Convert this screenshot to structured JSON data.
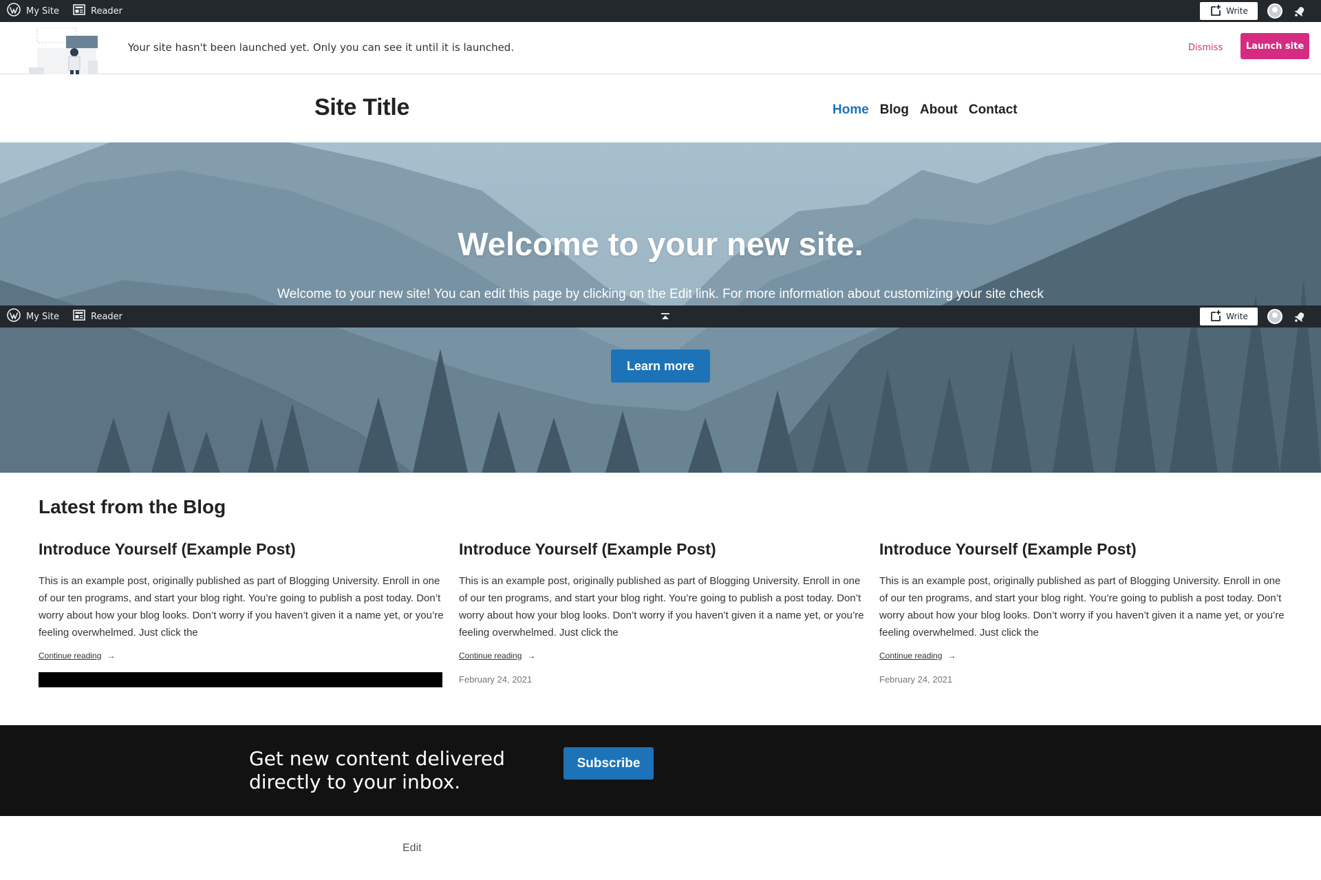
{
  "admin_bar": {
    "my_site_label": "My Site",
    "reader_label": "Reader",
    "write_label": "Write"
  },
  "banner": {
    "message": "Your site hasn't been launched yet. Only you can see it until it is launched.",
    "dismiss_label": "Dismiss",
    "launch_label": "Launch site"
  },
  "header": {
    "site_title": "Site Title",
    "nav": [
      {
        "label": "Home",
        "active": true
      },
      {
        "label": "Blog",
        "active": false
      },
      {
        "label": "About",
        "active": false
      },
      {
        "label": "Contact",
        "active": false
      }
    ]
  },
  "hero": {
    "title": "Welcome to your new site.",
    "text": "Welcome to your new site! You can edit this page by clicking on the Edit link. For more information about customizing your site check",
    "button_label": "Learn more"
  },
  "blog": {
    "heading": "Latest from the Blog",
    "posts": [
      {
        "title": "Introduce Yourself (Example Post)",
        "excerpt": "This is an example post, originally published as part of Blogging University. Enroll in one of our ten programs, and start your blog right. You’re going to publish a post today. Don’t worry about how your blog looks. Don’t worry if you haven’t given it a name yet, or you’re feeling overwhelmed. Just click the",
        "more_label": "Continue reading",
        "arrow": "→",
        "date": ""
      },
      {
        "title": "Introduce Yourself (Example Post)",
        "excerpt": "This is an example post, originally published as part of Blogging University. Enroll in one of our ten programs, and start your blog right. You’re going to publish a post today. Don’t worry about how your blog looks. Don’t worry if you haven’t given it a name yet, or you’re feeling overwhelmed. Just click the",
        "more_label": "Continue reading",
        "arrow": "→",
        "date": "February 24, 2021"
      },
      {
        "title": "Introduce Yourself (Example Post)",
        "excerpt": "This is an example post, originally published as part of Blogging University. Enroll in one of our ten programs, and start your blog right. You’re going to publish a post today. Don’t worry about how your blog looks. Don’t worry if you haven’t given it a name yet, or you’re feeling overwhelmed. Just click the",
        "more_label": "Continue reading",
        "arrow": "→",
        "date": "February 24, 2021"
      }
    ]
  },
  "subscribe": {
    "text_line1": "Get new content delivered",
    "text_line2": "directly to your inbox.",
    "button_label": "Subscribe"
  },
  "footer": {
    "edit_label": "Edit"
  },
  "colors": {
    "admin_bar_bg": "#23282d",
    "launch_button": "#d52c82",
    "dismiss_link": "#c9356e",
    "accent_blue": "#1c73b8",
    "nav_active": "#1a73b8",
    "subscribe_bg": "#121212"
  },
  "icons": {
    "wordpress": "wordpress-logo-icon",
    "reader": "reader-icon",
    "write": "write-plus-icon",
    "notifications": "bell-icon",
    "collapse": "collapse-up-icon"
  }
}
